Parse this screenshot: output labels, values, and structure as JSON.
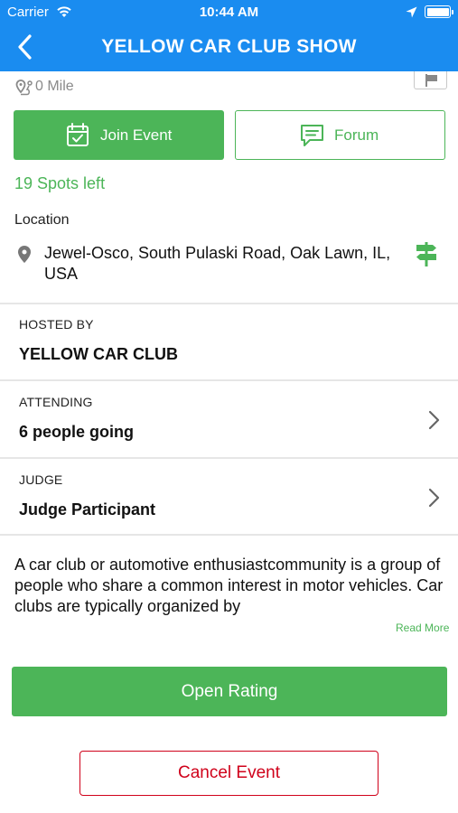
{
  "status_bar": {
    "carrier": "Carrier",
    "time": "10:44 AM"
  },
  "nav": {
    "title": "YELLOW CAR CLUB SHOW"
  },
  "event": {
    "distance": "0 Mile",
    "join_label": "Join Event",
    "forum_label": "Forum",
    "spots_left": "19 Spots left",
    "location_label": "Location",
    "address": "Jewel-Osco, South Pulaski Road, Oak Lawn, IL, USA"
  },
  "hosted_by": {
    "label": "HOSTED BY",
    "value": "YELLOW CAR CLUB"
  },
  "attending": {
    "label": "ATTENDING",
    "value": "6 people going"
  },
  "judge": {
    "label": "JUDGE",
    "value": "Judge Participant"
  },
  "description": {
    "text": "A car club or automotive enthusiastcommunity is a group of people who share a common interest in motor vehicles. Car clubs are typically organized by",
    "read_more": "Read More"
  },
  "actions": {
    "open_rating": "Open Rating",
    "cancel_event": "Cancel Event"
  },
  "colors": {
    "header": "#1a8cf0",
    "accent_green": "#4cb558",
    "danger_red": "#d0021b"
  },
  "icons": {
    "wifi": "wifi-icon",
    "location_arrow": "location-arrow-icon",
    "battery": "battery-icon",
    "back": "chevron-left-icon",
    "distance": "route-pin-icon",
    "flag": "flag-icon",
    "join": "calendar-check-icon",
    "forum": "chat-bubble-icon",
    "pin": "map-pin-icon",
    "directions": "signpost-icon",
    "chevron": "chevron-right-icon"
  }
}
